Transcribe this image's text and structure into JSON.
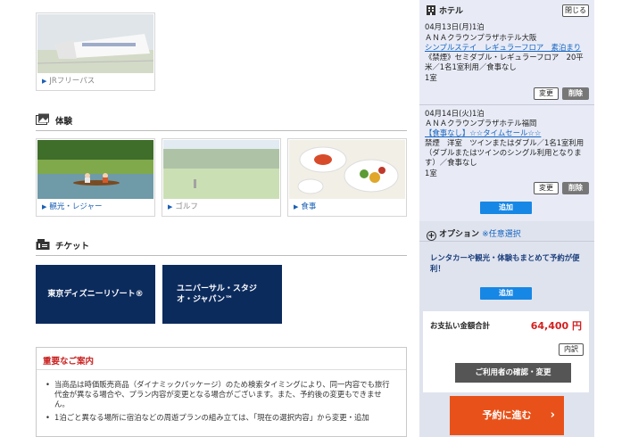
{
  "top_card": {
    "label": "JRフリーパス"
  },
  "experience": {
    "title": "体験",
    "cards": [
      {
        "label": "観光・レジャー"
      },
      {
        "label": "ゴルフ"
      },
      {
        "label": "食事"
      }
    ]
  },
  "ticket": {
    "title": "チケット",
    "items": [
      {
        "label": "東京ディズニーリゾート®"
      },
      {
        "label": "ユニバーサル・スタジオ・ジャパン™"
      }
    ]
  },
  "notice": {
    "title": "重要なご案内",
    "items": [
      "当商品は時価販売商品（ダイナミックパッケージ）のため検索タイミングにより、同一内容でも旅行代金が異なる場合や、プラン内容が変更となる場合がございます。また、予約後の変更もできません。",
      "1泊ごと異なる場所に宿泊などの周遊プランの組み立ては、「現在の選択内容」から変更・追加"
    ]
  },
  "hotel_panel": {
    "title": "ホテル",
    "close_label": "閉じる",
    "stays": [
      {
        "date": "04月13日(月)1泊",
        "hotel": "ＡＮＡクラウンプラザホテル大阪",
        "plan": "シンプルステイ　レギュラーフロア　素泊まり",
        "room": "《禁煙》セミダブル・レギュラーフロア　20平米／1名1室利用／食事なし",
        "count": "1室",
        "change_label": "変更",
        "delete_label": "削除"
      },
      {
        "date": "04月14日(火)1泊",
        "hotel": "ＡＮＡクラウンプラザホテル福岡",
        "plan": "【食事なし】☆☆タイムセール☆☆",
        "room": "禁煙　洋室　ツインまたはダブル／1名1室利用（ダブルまたはツインのシングル利用となります）／食事なし",
        "count": "1室",
        "change_label": "変更",
        "delete_label": "削除"
      }
    ],
    "add_label": "追加"
  },
  "option": {
    "title": "オプション",
    "note": "※任意選択",
    "promo": "レンタカーや観光・体験もまとめて予約が便利！",
    "add_label": "追加"
  },
  "total": {
    "label": "お支払い金額合計",
    "value": "64,400 円",
    "breakdown_label": "内訳",
    "confirm_label": "ご利用者の確認・変更"
  },
  "proceed_label": "予約に進む",
  "colors": {
    "navy": "#0c2b5d",
    "accent_red": "#d31f1f",
    "cta_orange": "#e8521a",
    "link_blue": "#1565c0"
  }
}
